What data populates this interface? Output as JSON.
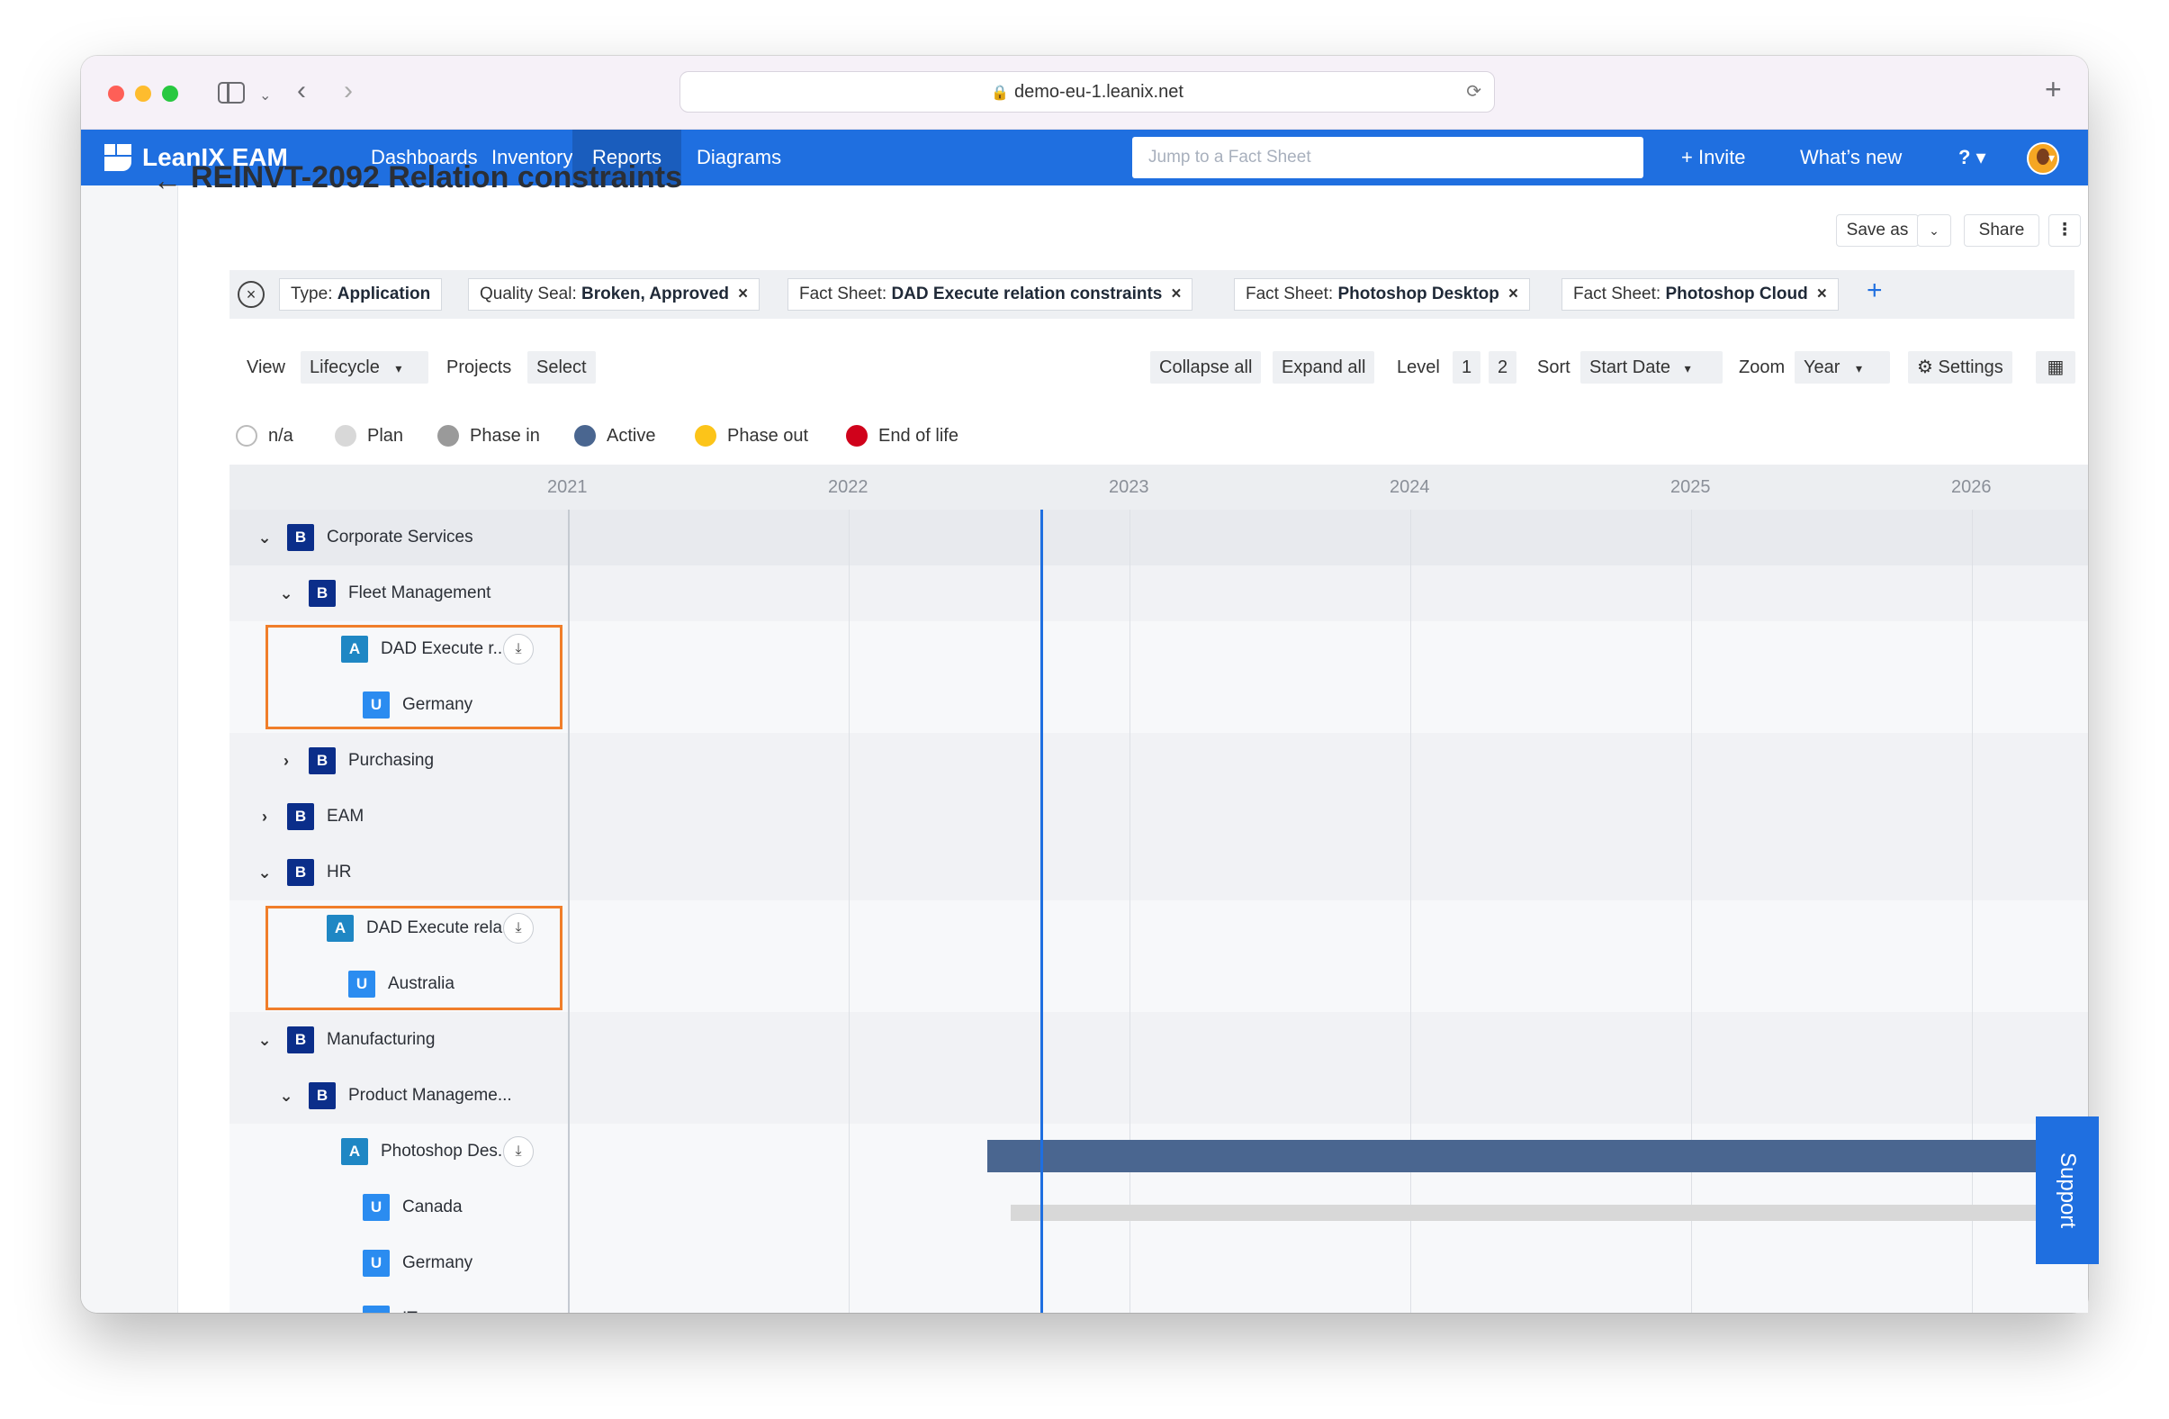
{
  "browser": {
    "url": "demo-eu-1.leanix.net"
  },
  "nav": {
    "brand": "LeanIX EAM",
    "items": [
      "Dashboards",
      "Inventory",
      "Reports",
      "Diagrams"
    ],
    "active": "Reports",
    "search_placeholder": "Jump to a Fact Sheet",
    "invite": "+ Invite",
    "whats_new": "What’s new",
    "help": "? ▾"
  },
  "page": {
    "title": "REINVT-2092 Relation constraints",
    "save_as": "Save as",
    "share": "Share",
    "more": "⋮"
  },
  "filters": [
    {
      "key": "Type:",
      "value": "Application",
      "removable": false
    },
    {
      "key": "Quality Seal:",
      "value": "Broken, Approved",
      "removable": true
    },
    {
      "key": "Fact Sheet:",
      "value": "DAD Execute relation constraints",
      "removable": true
    },
    {
      "key": "Fact Sheet:",
      "value": "Photoshop Desktop",
      "removable": true
    },
    {
      "key": "Fact Sheet:",
      "value": "Photoshop Cloud",
      "removable": true
    }
  ],
  "toolbar": {
    "view_label": "View",
    "view_value": "Lifecycle",
    "projects_label": "Projects",
    "projects_value": "Select",
    "collapse_all": "Collapse all",
    "expand_all": "Expand all",
    "level_label": "Level",
    "level_1": "1",
    "level_2": "2",
    "sort_label": "Sort",
    "sort_value": "Start Date",
    "zoom_label": "Zoom",
    "zoom_value": "Year",
    "settings": "Settings"
  },
  "legend": [
    {
      "label": "n/a",
      "color": "#ffffff"
    },
    {
      "label": "Plan",
      "color": "#d8d8d8"
    },
    {
      "label": "Phase in",
      "color": "#9a9a9a"
    },
    {
      "label": "Active",
      "color": "#4a6690"
    },
    {
      "label": "Phase out",
      "color": "#fcc419"
    },
    {
      "label": "End of life",
      "color": "#d0021b"
    }
  ],
  "timeline": {
    "years": [
      "2021",
      "2022",
      "2023",
      "2024",
      "2025",
      "2026"
    ]
  },
  "rows": [
    {
      "label": "Corporate Services",
      "badge": "B",
      "chevron": "⌄"
    },
    {
      "label": "Fleet Management",
      "badge": "B",
      "chevron": "⌄"
    },
    {
      "label": "DAD Execute r...",
      "badge": "A",
      "chevron": ""
    },
    {
      "label": "Germany",
      "badge": "U",
      "chevron": ""
    },
    {
      "label": "Purchasing",
      "badge": "B",
      "chevron": "›"
    },
    {
      "label": "EAM",
      "badge": "B",
      "chevron": "›"
    },
    {
      "label": "HR",
      "badge": "B",
      "chevron": "⌄"
    },
    {
      "label": "DAD Execute rela...",
      "badge": "A",
      "chevron": ""
    },
    {
      "label": "Australia",
      "badge": "U",
      "chevron": ""
    },
    {
      "label": "Manufacturing",
      "badge": "B",
      "chevron": "⌄"
    },
    {
      "label": "Product Manageme...",
      "badge": "B",
      "chevron": "⌄"
    },
    {
      "label": "Photoshop Des...",
      "badge": "A",
      "chevron": ""
    },
    {
      "label": "Canada",
      "badge": "U",
      "chevron": ""
    },
    {
      "label": "Germany",
      "badge": "U",
      "chevron": ""
    },
    {
      "label": "IT",
      "badge": "U",
      "chevron": ""
    }
  ],
  "support": "Support",
  "colors": {
    "brand": "#1f6fe0",
    "highlight": "#f07e2a",
    "active_bar": "#4a6690",
    "plan_bar": "#d8d8d8"
  }
}
